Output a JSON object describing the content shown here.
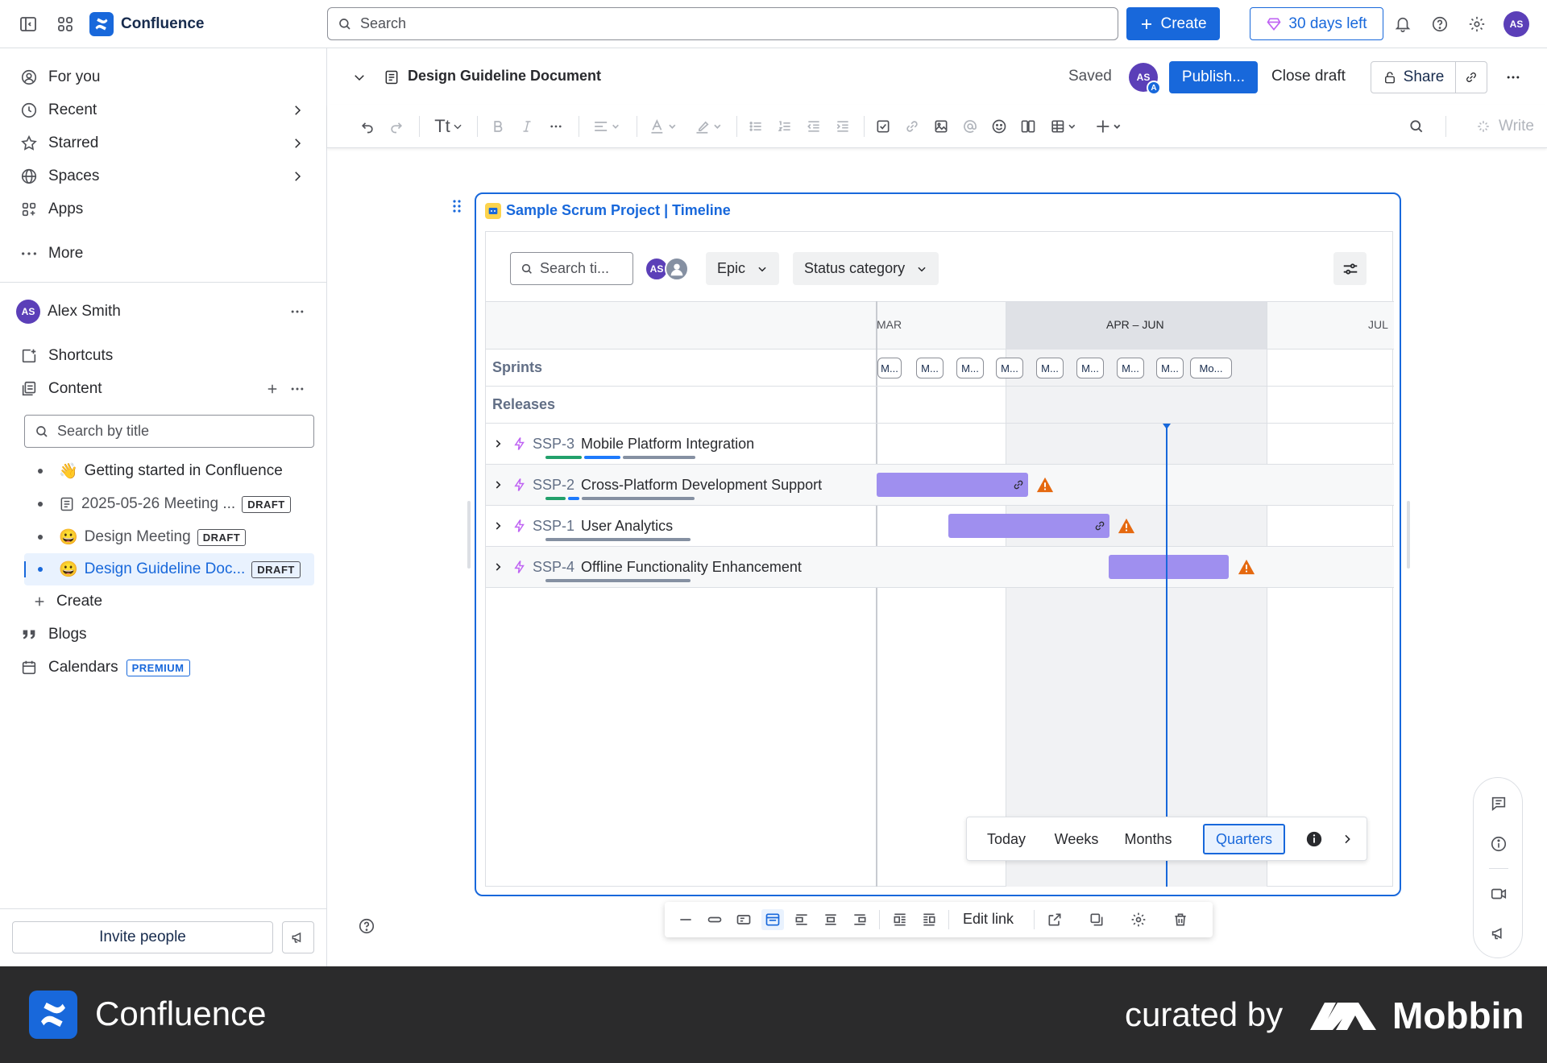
{
  "topnav": {
    "app_name": "Confluence",
    "search_placeholder": "Search",
    "create_label": "Create",
    "trial_label": "30 days left",
    "user_initials": "AS"
  },
  "sidebar": {
    "nav": [
      {
        "label": "For you",
        "icon": "person-circle-icon"
      },
      {
        "label": "Recent",
        "icon": "clock-icon"
      },
      {
        "label": "Starred",
        "icon": "star-icon"
      },
      {
        "label": "Spaces",
        "icon": "globe-icon"
      },
      {
        "label": "Apps",
        "icon": "apps-icon"
      },
      {
        "label": "More",
        "icon": "more-icon"
      }
    ],
    "space_owner": "Alex Smith",
    "space_initials": "AS",
    "shortcuts_label": "Shortcuts",
    "content_label": "Content",
    "title_search_placeholder": "Search by title",
    "tree": [
      {
        "emoji": "👋",
        "label": "Getting started in Confluence",
        "badge": ""
      },
      {
        "emoji": "",
        "label": "2025-05-26 Meeting ...",
        "badge": "DRAFT"
      },
      {
        "emoji": "😀",
        "label": "Design Meeting",
        "badge": "DRAFT"
      },
      {
        "emoji": "😀",
        "label": "Design Guideline Doc...",
        "badge": "DRAFT"
      }
    ],
    "create_label": "Create",
    "blogs_label": "Blogs",
    "calendars_label": "Calendars",
    "premium_badge": "PREMIUM",
    "invite_label": "Invite people"
  },
  "page": {
    "title": "Design Guideline Document",
    "saved_label": "Saved",
    "collab_initials": "AS",
    "collab_badge": "A",
    "publish_label": "Publish...",
    "close_draft_label": "Close draft",
    "share_label": "Share"
  },
  "toolbar": {
    "text_style": "Tt",
    "write_label": "Write"
  },
  "macro": {
    "title": "Sample Scrum Project | Timeline",
    "search_placeholder": "Search ti...",
    "assignee_initials": "AS",
    "epic_filter": "Epic",
    "status_filter": "Status category",
    "quarters": [
      "MAR",
      "APR – JUN",
      "JUL"
    ],
    "sprints_label": "Sprints",
    "sprints": [
      "M...",
      "M...",
      "M...",
      "M...",
      "M...",
      "M...",
      "M...",
      "M...",
      "Mo..."
    ],
    "releases_label": "Releases",
    "issues": [
      {
        "key": "SSP-3",
        "title": "Mobile Platform Integration",
        "progress": {
          "done": 0.25,
          "in_progress": 0.25,
          "todo": 0.5
        }
      },
      {
        "key": "SSP-2",
        "title": "Cross-Platform Development Support",
        "progress": {
          "done": 0.14,
          "in_progress": 0.08,
          "todo": 0.78
        }
      },
      {
        "key": "SSP-1",
        "title": "User Analytics",
        "progress": {
          "done": 0,
          "in_progress": 0,
          "todo": 1
        }
      },
      {
        "key": "SSP-4",
        "title": "Offline Functionality Enhancement",
        "progress": {
          "done": 0,
          "in_progress": 0,
          "todo": 1
        }
      }
    ],
    "views": [
      "Today",
      "Weeks",
      "Months",
      "Quarters"
    ],
    "active_view": "Quarters"
  },
  "floating_toolbar": {
    "edit_link_label": "Edit link"
  },
  "footer": {
    "app_name": "Confluence",
    "curated_label": "curated by",
    "brand": "Mobbin"
  },
  "colors": {
    "accent": "#1868db",
    "epic_bar": "#9f8fef",
    "warning": "#e56910",
    "today_line": "#1868db",
    "progress_done": "#22a06b",
    "progress_in_progress": "#1d7afc",
    "progress_todo": "#8590a2"
  }
}
